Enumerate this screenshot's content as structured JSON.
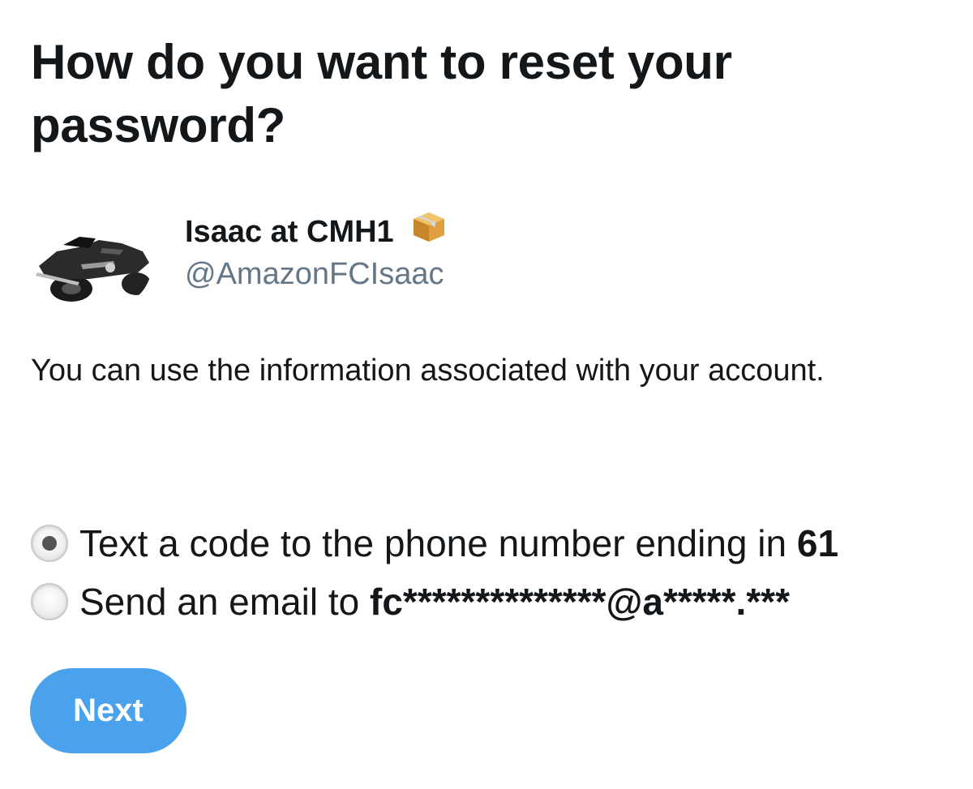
{
  "header": {
    "title": "How do you want to reset your password?"
  },
  "account": {
    "display_name": "Isaac at CMH1",
    "display_name_emoji": "package-emoji",
    "handle": "@AmazonFCIsaac",
    "avatar": "motorcycle-avatar"
  },
  "main": {
    "info_text": "You can use the information associated with your account."
  },
  "options": [
    {
      "label_prefix": "Text a code to the phone number ending in ",
      "label_bold": "61",
      "selected": true
    },
    {
      "label_prefix": "Send an email to ",
      "label_bold": "fc**************@a*****.***",
      "selected": false
    }
  ],
  "actions": {
    "next_label": "Next"
  },
  "colors": {
    "primary_button": "#4aa1ec",
    "handle_text": "#657786",
    "text": "#14171a"
  }
}
